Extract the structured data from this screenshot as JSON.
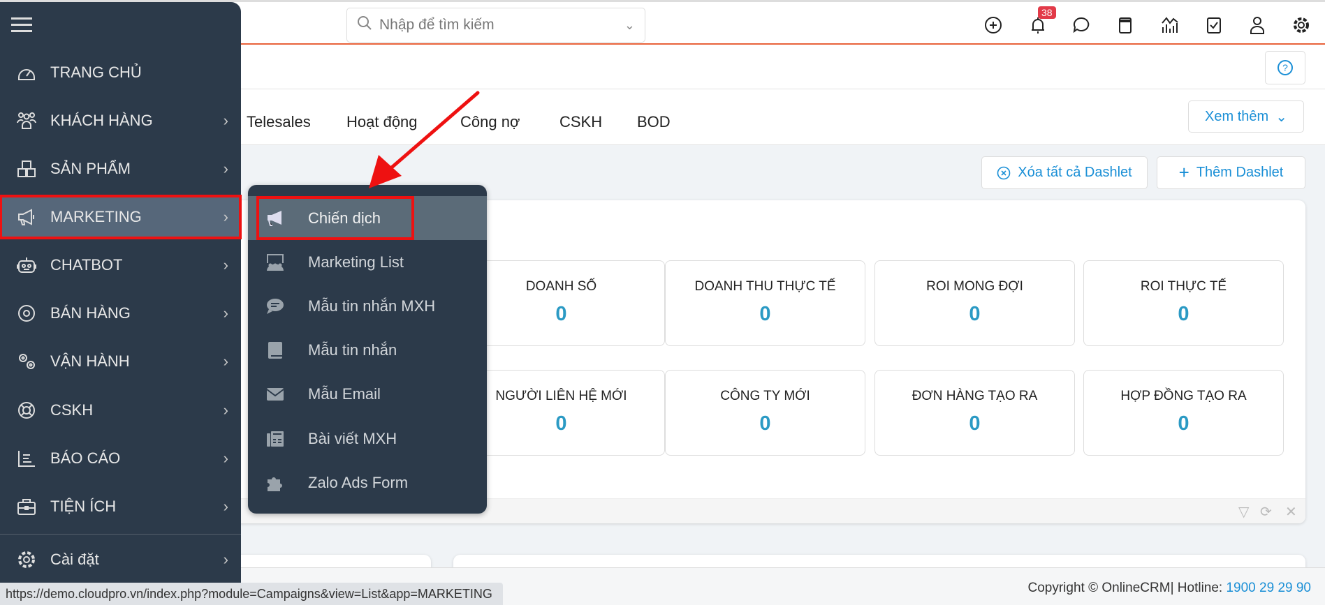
{
  "search": {
    "placeholder": "Nhập để tìm kiếm",
    "icon": "search-icon"
  },
  "header": {
    "notifications_count": "38",
    "icons": [
      "plus-circle-icon",
      "bell-icon",
      "chat-icon",
      "calendar-icon",
      "chart-icon",
      "checkbox-icon",
      "user-icon",
      "gear-icon"
    ]
  },
  "tabs": [
    {
      "label": "Telesales"
    },
    {
      "label": "Hoạt động"
    },
    {
      "label": "Công nợ"
    },
    {
      "label": "CSKH"
    },
    {
      "label": "BOD"
    }
  ],
  "toolbar": {
    "more_label": "Xem thêm",
    "clear_label": "Xóa tất cả Dashlet",
    "add_label": "Thêm Dashlet"
  },
  "stats": [
    {
      "label": "DOANH SỐ",
      "value": "0"
    },
    {
      "label": "DOANH THU THỰC TẾ",
      "value": "0"
    },
    {
      "label": "ROI MONG ĐỢI",
      "value": "0"
    },
    {
      "label": "ROI THỰC TẾ",
      "value": "0"
    },
    {
      "label": "NGƯỜI LIÊN HỆ MỚI",
      "value": "0"
    },
    {
      "label": "CÔNG TY MỚI",
      "value": "0"
    },
    {
      "label": "ĐƠN HÀNG TẠO RA",
      "value": "0"
    },
    {
      "label": "HỢP ĐỒNG TẠO RA",
      "value": "0"
    }
  ],
  "sidebar": {
    "items": [
      {
        "label": "TRANG CHỦ",
        "icon": "dashboard-icon",
        "arrow": false
      },
      {
        "label": "KHÁCH HÀNG",
        "icon": "users-icon",
        "arrow": true
      },
      {
        "label": "SẢN PHẨM",
        "icon": "boxes-icon",
        "arrow": true
      },
      {
        "label": "MARKETING",
        "icon": "megaphone-icon",
        "arrow": true,
        "active": true
      },
      {
        "label": "CHATBOT",
        "icon": "robot-icon",
        "arrow": true
      },
      {
        "label": "BÁN HÀNG",
        "icon": "target-icon",
        "arrow": true
      },
      {
        "label": "VẬN HÀNH",
        "icon": "gears-icon",
        "arrow": true
      },
      {
        "label": "CSKH",
        "icon": "lifebuoy-icon",
        "arrow": true
      },
      {
        "label": "BÁO CÁO",
        "icon": "report-icon",
        "arrow": true
      },
      {
        "label": "TIỆN ÍCH",
        "icon": "briefcase-icon",
        "arrow": true
      }
    ],
    "settings": {
      "label": "Cài đặt",
      "icon": "gear-icon"
    }
  },
  "submenu": {
    "items": [
      {
        "label": "Chiến dịch",
        "icon": "megaphone-icon",
        "active": true
      },
      {
        "label": "Marketing List",
        "icon": "audience-icon"
      },
      {
        "label": "Mẫu tin nhắn MXH",
        "icon": "comment-icon"
      },
      {
        "label": "Mẫu tin nhắn",
        "icon": "book-icon"
      },
      {
        "label": "Mẫu Email",
        "icon": "envelope-icon"
      },
      {
        "label": "Bài viết MXH",
        "icon": "fax-icon"
      },
      {
        "label": "Zalo Ads Form",
        "icon": "puzzle-icon"
      }
    ]
  },
  "footer": {
    "copyright": "Copyright © OnlineCRM",
    "hotline_label": "| Hotline: ",
    "hotline": "1900 29 29 90"
  },
  "status_url": "https://demo.cloudpro.vn/index.php?module=Campaigns&view=List&app=MARKETING",
  "colors": {
    "sidebar": "#2c3a4a",
    "accent": "#1a8fd6",
    "highlight": "#ee1111",
    "value": "#2b9ac4",
    "header_line": "#e8623a"
  }
}
